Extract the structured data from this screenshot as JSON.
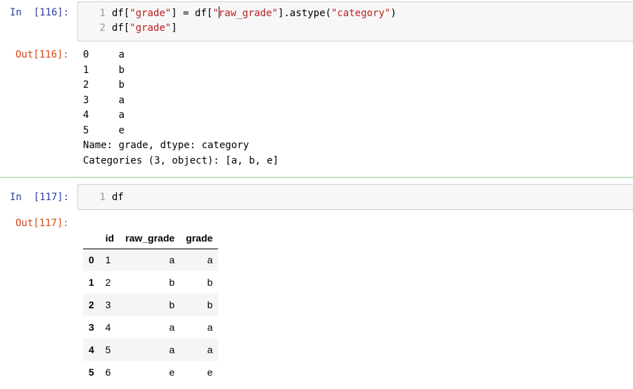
{
  "cell116": {
    "in_prompt": "In  [116]:",
    "line_numbers": [
      "1",
      "2"
    ],
    "code_line1": {
      "p1": "df[",
      "s1": "\"grade\"",
      "p2": "] = df[",
      "s2a": "\"",
      "s2b": "raw_grade\"",
      "p3": "].astype(",
      "s3": "\"category\"",
      "p4": ")"
    },
    "code_line2": {
      "p1": "df[",
      "s1": "\"grade\"",
      "p2": "]"
    },
    "out_prompt": "Out[116]:",
    "output_lines": [
      "0     a",
      "1     b",
      "2     b",
      "3     a",
      "4     a",
      "5     e",
      "Name: grade, dtype: category",
      "Categories (3, object): [a, b, e]"
    ]
  },
  "cell117": {
    "in_prompt": "In  [117]:",
    "line_numbers": [
      "1"
    ],
    "code": "df",
    "out_prompt": "Out[117]:",
    "table": {
      "columns": [
        "",
        "id",
        "raw_grade",
        "grade"
      ],
      "rows": [
        {
          "index": "0",
          "id": "1",
          "raw_grade": "a",
          "grade": "a"
        },
        {
          "index": "1",
          "id": "2",
          "raw_grade": "b",
          "grade": "b"
        },
        {
          "index": "2",
          "id": "3",
          "raw_grade": "b",
          "grade": "b"
        },
        {
          "index": "3",
          "id": "4",
          "raw_grade": "a",
          "grade": "a"
        },
        {
          "index": "4",
          "id": "5",
          "raw_grade": "a",
          "grade": "a"
        },
        {
          "index": "5",
          "id": "6",
          "raw_grade": "e",
          "grade": "e"
        }
      ]
    }
  },
  "colors": {
    "in_prompt": "#303f9f",
    "out_prompt": "#d84315",
    "string": "#ba2121",
    "operator": "#aa22ff",
    "divider": "#8ec98e"
  }
}
